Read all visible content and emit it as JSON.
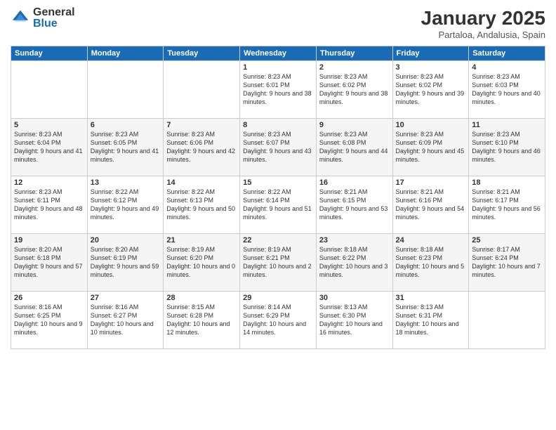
{
  "logo": {
    "general": "General",
    "blue": "Blue"
  },
  "title": "January 2025",
  "subtitle": "Partaloa, Andalusia, Spain",
  "days_of_week": [
    "Sunday",
    "Monday",
    "Tuesday",
    "Wednesday",
    "Thursday",
    "Friday",
    "Saturday"
  ],
  "weeks": [
    [
      {
        "day": "",
        "info": ""
      },
      {
        "day": "",
        "info": ""
      },
      {
        "day": "",
        "info": ""
      },
      {
        "day": "1",
        "info": "Sunrise: 8:23 AM\nSunset: 6:01 PM\nDaylight: 9 hours and 38 minutes."
      },
      {
        "day": "2",
        "info": "Sunrise: 8:23 AM\nSunset: 6:02 PM\nDaylight: 9 hours and 38 minutes."
      },
      {
        "day": "3",
        "info": "Sunrise: 8:23 AM\nSunset: 6:02 PM\nDaylight: 9 hours and 39 minutes."
      },
      {
        "day": "4",
        "info": "Sunrise: 8:23 AM\nSunset: 6:03 PM\nDaylight: 9 hours and 40 minutes."
      }
    ],
    [
      {
        "day": "5",
        "info": "Sunrise: 8:23 AM\nSunset: 6:04 PM\nDaylight: 9 hours and 41 minutes."
      },
      {
        "day": "6",
        "info": "Sunrise: 8:23 AM\nSunset: 6:05 PM\nDaylight: 9 hours and 41 minutes."
      },
      {
        "day": "7",
        "info": "Sunrise: 8:23 AM\nSunset: 6:06 PM\nDaylight: 9 hours and 42 minutes."
      },
      {
        "day": "8",
        "info": "Sunrise: 8:23 AM\nSunset: 6:07 PM\nDaylight: 9 hours and 43 minutes."
      },
      {
        "day": "9",
        "info": "Sunrise: 8:23 AM\nSunset: 6:08 PM\nDaylight: 9 hours and 44 minutes."
      },
      {
        "day": "10",
        "info": "Sunrise: 8:23 AM\nSunset: 6:09 PM\nDaylight: 9 hours and 45 minutes."
      },
      {
        "day": "11",
        "info": "Sunrise: 8:23 AM\nSunset: 6:10 PM\nDaylight: 9 hours and 46 minutes."
      }
    ],
    [
      {
        "day": "12",
        "info": "Sunrise: 8:23 AM\nSunset: 6:11 PM\nDaylight: 9 hours and 48 minutes."
      },
      {
        "day": "13",
        "info": "Sunrise: 8:22 AM\nSunset: 6:12 PM\nDaylight: 9 hours and 49 minutes."
      },
      {
        "day": "14",
        "info": "Sunrise: 8:22 AM\nSunset: 6:13 PM\nDaylight: 9 hours and 50 minutes."
      },
      {
        "day": "15",
        "info": "Sunrise: 8:22 AM\nSunset: 6:14 PM\nDaylight: 9 hours and 51 minutes."
      },
      {
        "day": "16",
        "info": "Sunrise: 8:21 AM\nSunset: 6:15 PM\nDaylight: 9 hours and 53 minutes."
      },
      {
        "day": "17",
        "info": "Sunrise: 8:21 AM\nSunset: 6:16 PM\nDaylight: 9 hours and 54 minutes."
      },
      {
        "day": "18",
        "info": "Sunrise: 8:21 AM\nSunset: 6:17 PM\nDaylight: 9 hours and 56 minutes."
      }
    ],
    [
      {
        "day": "19",
        "info": "Sunrise: 8:20 AM\nSunset: 6:18 PM\nDaylight: 9 hours and 57 minutes."
      },
      {
        "day": "20",
        "info": "Sunrise: 8:20 AM\nSunset: 6:19 PM\nDaylight: 9 hours and 59 minutes."
      },
      {
        "day": "21",
        "info": "Sunrise: 8:19 AM\nSunset: 6:20 PM\nDaylight: 10 hours and 0 minutes."
      },
      {
        "day": "22",
        "info": "Sunrise: 8:19 AM\nSunset: 6:21 PM\nDaylight: 10 hours and 2 minutes."
      },
      {
        "day": "23",
        "info": "Sunrise: 8:18 AM\nSunset: 6:22 PM\nDaylight: 10 hours and 3 minutes."
      },
      {
        "day": "24",
        "info": "Sunrise: 8:18 AM\nSunset: 6:23 PM\nDaylight: 10 hours and 5 minutes."
      },
      {
        "day": "25",
        "info": "Sunrise: 8:17 AM\nSunset: 6:24 PM\nDaylight: 10 hours and 7 minutes."
      }
    ],
    [
      {
        "day": "26",
        "info": "Sunrise: 8:16 AM\nSunset: 6:25 PM\nDaylight: 10 hours and 9 minutes."
      },
      {
        "day": "27",
        "info": "Sunrise: 8:16 AM\nSunset: 6:27 PM\nDaylight: 10 hours and 10 minutes."
      },
      {
        "day": "28",
        "info": "Sunrise: 8:15 AM\nSunset: 6:28 PM\nDaylight: 10 hours and 12 minutes."
      },
      {
        "day": "29",
        "info": "Sunrise: 8:14 AM\nSunset: 6:29 PM\nDaylight: 10 hours and 14 minutes."
      },
      {
        "day": "30",
        "info": "Sunrise: 8:13 AM\nSunset: 6:30 PM\nDaylight: 10 hours and 16 minutes."
      },
      {
        "day": "31",
        "info": "Sunrise: 8:13 AM\nSunset: 6:31 PM\nDaylight: 10 hours and 18 minutes."
      },
      {
        "day": "",
        "info": ""
      }
    ]
  ]
}
